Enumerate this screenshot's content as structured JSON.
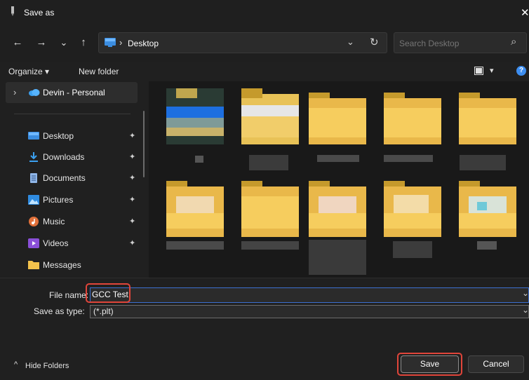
{
  "window": {
    "title": "Save as",
    "close": "✕"
  },
  "nav": {
    "back_icon": "←",
    "forward_icon": "→",
    "recent_icon": "⌄",
    "up_icon": "↑",
    "path_separator": "›",
    "path_location": "Desktop",
    "dropdown_icon": "⌄",
    "refresh_icon": "↻",
    "search_placeholder": "Search Desktop",
    "search_icon": "⌕"
  },
  "toolbar": {
    "organize_label": "Organize ▾",
    "new_folder_label": "New folder",
    "view_caret": "▾",
    "help_label": "?"
  },
  "sidebar": {
    "expand_icon": "›",
    "cloud_label": "Devin - Personal",
    "items": [
      {
        "label": "Desktop",
        "icon": "desktop-icon",
        "pinned": true
      },
      {
        "label": "Downloads",
        "icon": "download-icon",
        "pinned": true
      },
      {
        "label": "Documents",
        "icon": "document-icon",
        "pinned": true
      },
      {
        "label": "Pictures",
        "icon": "pictures-icon",
        "pinned": true
      },
      {
        "label": "Music",
        "icon": "music-icon",
        "pinned": true
      },
      {
        "label": "Videos",
        "icon": "videos-icon",
        "pinned": true
      },
      {
        "label": "Messages",
        "icon": "folder-icon",
        "pinned": false
      }
    ],
    "pin_glyph": "📌"
  },
  "form": {
    "file_name_label": "File name:",
    "file_name_value": "GCC Test",
    "save_type_label": "Save as type:",
    "save_type_value": "(*.plt)",
    "caret": "⌄"
  },
  "footer": {
    "hide_folders_label": "Hide Folders",
    "hide_icon": "^",
    "save_label": "Save",
    "cancel_label": "Cancel"
  },
  "colors": {
    "accent": "#4cc2ff",
    "highlight": "#e0453a",
    "folder": "#f3c24c"
  }
}
